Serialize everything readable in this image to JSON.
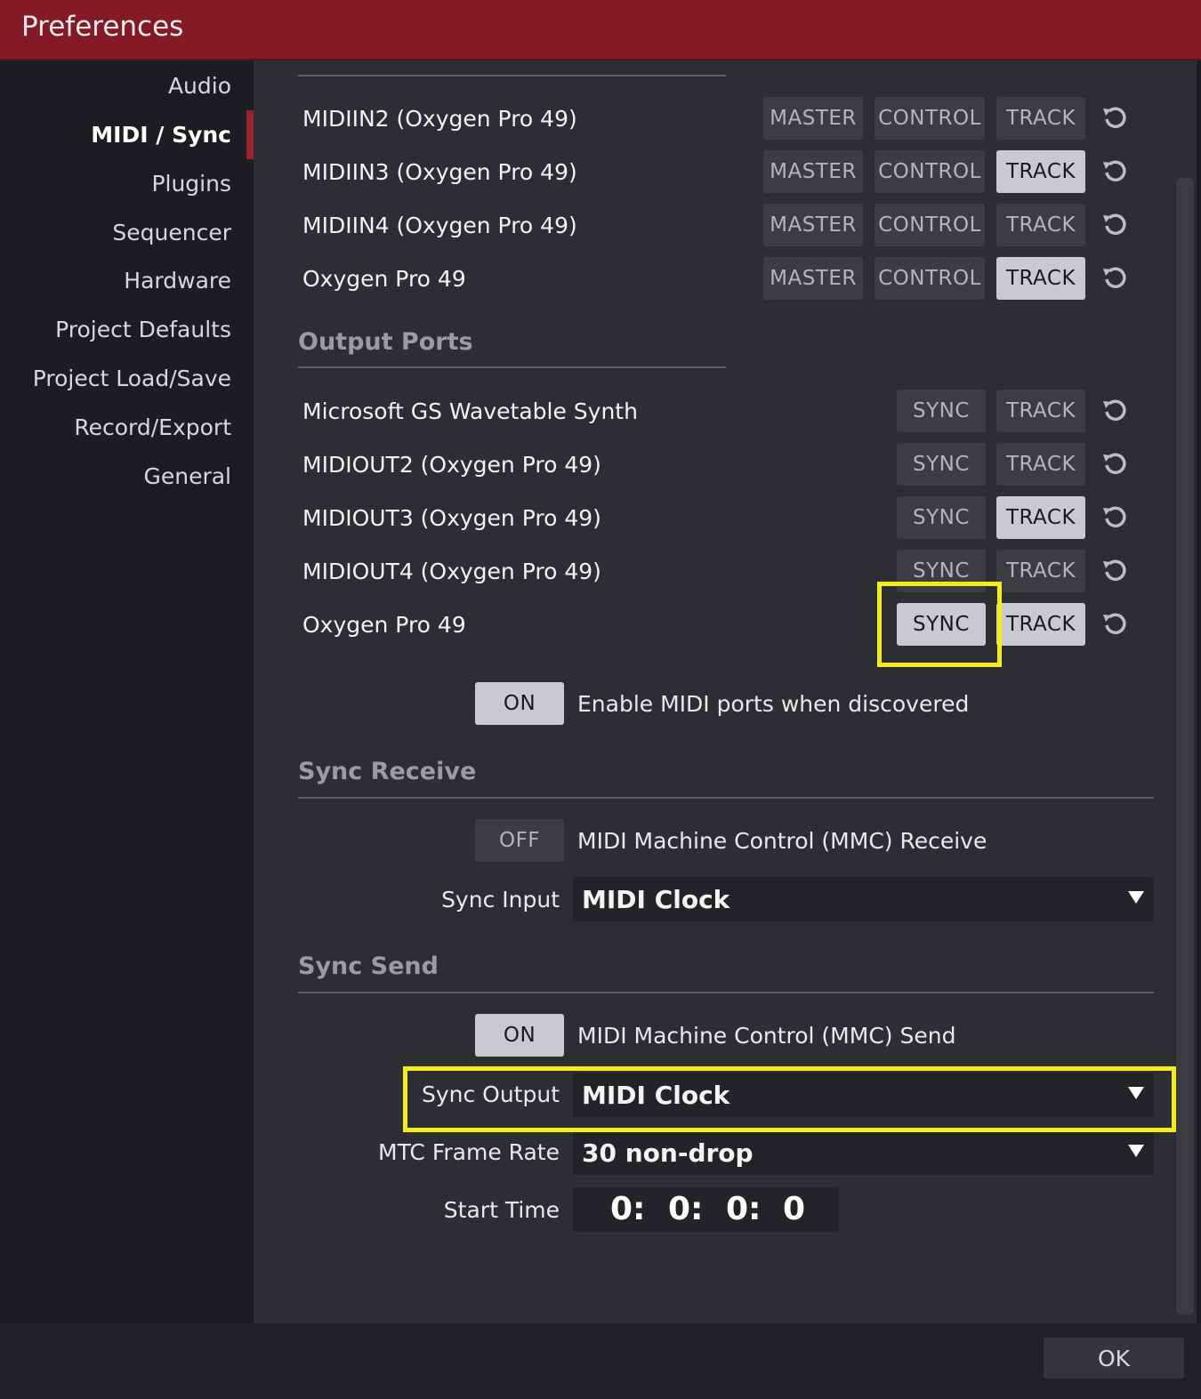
{
  "window": {
    "title": "Preferences"
  },
  "sidebar": {
    "items": [
      {
        "label": "Audio"
      },
      {
        "label": "MIDI / Sync"
      },
      {
        "label": "Plugins"
      },
      {
        "label": "Sequencer"
      },
      {
        "label": "Hardware"
      },
      {
        "label": "Project Defaults"
      },
      {
        "label": "Project Load/Save"
      },
      {
        "label": "Record/Export"
      },
      {
        "label": "General"
      }
    ],
    "active": "MIDI / Sync"
  },
  "input_ports": [
    {
      "name": "MIDIIN2 (Oxygen Pro 49)",
      "master": "MASTER",
      "control": "CONTROL",
      "track": "TRACK",
      "track_on": false
    },
    {
      "name": "MIDIIN3 (Oxygen Pro 49)",
      "master": "MASTER",
      "control": "CONTROL",
      "track": "TRACK",
      "track_on": true
    },
    {
      "name": "MIDIIN4 (Oxygen Pro 49)",
      "master": "MASTER",
      "control": "CONTROL",
      "track": "TRACK",
      "track_on": false
    },
    {
      "name": "Oxygen Pro 49",
      "master": "MASTER",
      "control": "CONTROL",
      "track": "TRACK",
      "track_on": true
    }
  ],
  "output_ports": {
    "title": "Output Ports",
    "ports": [
      {
        "name": "Microsoft GS Wavetable Synth",
        "sync": "SYNC",
        "track": "TRACK",
        "sync_on": false,
        "track_on": false
      },
      {
        "name": "MIDIOUT2 (Oxygen Pro 49)",
        "sync": "SYNC",
        "track": "TRACK",
        "sync_on": false,
        "track_on": false
      },
      {
        "name": "MIDIOUT3 (Oxygen Pro 49)",
        "sync": "SYNC",
        "track": "TRACK",
        "sync_on": false,
        "track_on": true
      },
      {
        "name": "MIDIOUT4 (Oxygen Pro 49)",
        "sync": "SYNC",
        "track": "TRACK",
        "sync_on": false,
        "track_on": false
      },
      {
        "name": "Oxygen Pro 49",
        "sync": "SYNC",
        "track": "TRACK",
        "sync_on": true,
        "track_on": true
      }
    ]
  },
  "enable_discovered": {
    "state": "ON",
    "label": "Enable MIDI ports when discovered"
  },
  "sync_receive": {
    "title": "Sync Receive",
    "mmc_state": "OFF",
    "mmc_label": "MIDI Machine Control (MMC) Receive",
    "sync_input_label": "Sync Input",
    "sync_input_value": "MIDI Clock"
  },
  "sync_send": {
    "title": "Sync Send",
    "mmc_state": "ON",
    "mmc_label": "MIDI Machine Control (MMC) Send",
    "sync_output_label": "Sync Output",
    "sync_output_value": "MIDI Clock",
    "mtc_label": "MTC Frame Rate",
    "mtc_value": "30 non-drop",
    "start_time_label": "Start Time",
    "start_time": [
      "0:",
      "0:",
      "0:",
      "0"
    ]
  },
  "footer": {
    "ok": "OK"
  },
  "colors": {
    "titlebar": "#831a26",
    "highlight": "#f6ec1a",
    "button_on": "#c9cacd",
    "button_off": "#3c3d42"
  },
  "icons": {
    "reset": "reset-icon",
    "dropdown": "chevron-down-icon"
  }
}
